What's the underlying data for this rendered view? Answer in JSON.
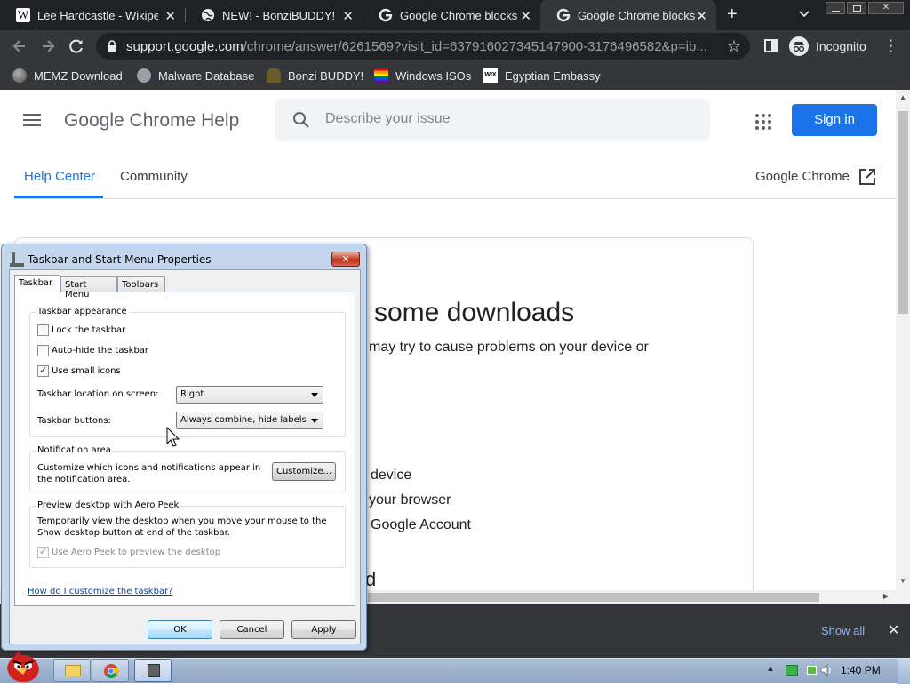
{
  "tabs": [
    {
      "title": "Lee Hardcastle - Wikipedia",
      "favicon": "wikipedia-icon"
    },
    {
      "title": "NEW! - BonziBUDDY!",
      "favicon": "globe-icon"
    },
    {
      "title": "Google Chrome blocks some downloads",
      "favicon": "google-icon"
    },
    {
      "title": "Google Chrome blocks some downloads",
      "favicon": "google-icon"
    }
  ],
  "new_tab_symbol": "+",
  "omnibox": {
    "domain": "support.google.com",
    "path": "/chrome/answer/6261569?visit_id=637916027345147900-3176496582&p=ib..."
  },
  "profile": {
    "label": "Incognito"
  },
  "bookmarks": [
    {
      "label": "MEMZ Download"
    },
    {
      "label": "Malware Database"
    },
    {
      "label": "Bonzi BUDDY!"
    },
    {
      "label": "Windows ISOs"
    },
    {
      "label": "Egyptian Embassy"
    }
  ],
  "help_page": {
    "title": "Google Chrome Help",
    "search_placeholder": "Describe your issue",
    "sign_in": "Sign in",
    "nav": {
      "help_center": "Help Center",
      "community": "Community",
      "product": "Google Chrome"
    },
    "article_heading": "some downloads",
    "article_intro": "may try to cause problems on your device or",
    "list_items": [
      "device",
      "your browser",
      "Google Account"
    ],
    "partial_heading": "d"
  },
  "downloads": {
    "show_all": "Show all"
  },
  "dialog": {
    "title": "Taskbar and Start Menu Properties",
    "tabs": [
      "Taskbar",
      "Start Menu",
      "Toolbars"
    ],
    "appearance": {
      "title": "Taskbar appearance",
      "lock": {
        "label": "Lock the taskbar",
        "checked": false
      },
      "autohide": {
        "label": "Auto-hide the taskbar",
        "checked": false
      },
      "small_icons": {
        "label": "Use small icons",
        "checked": true
      },
      "location_label": "Taskbar location on screen:",
      "location_value": "Right",
      "buttons_label": "Taskbar buttons:",
      "buttons_value": "Always combine, hide labels"
    },
    "notification": {
      "title": "Notification area",
      "text": "Customize which icons and notifications appear in the notification area.",
      "button": "Customize..."
    },
    "peek": {
      "title": "Preview desktop with Aero Peek",
      "text": "Temporarily view the desktop when you move your mouse to the Show desktop button at end of the taskbar.",
      "checkbox": {
        "label": "Use Aero Peek to preview the desktop",
        "checked": true,
        "disabled": true
      }
    },
    "help_link": "How do I customize the taskbar?",
    "buttons": {
      "ok": "OK",
      "cancel": "Cancel",
      "apply": "Apply"
    }
  },
  "taskbar": {
    "clock": "1:40 PM"
  },
  "colors": {
    "chrome_dark": "#202124",
    "toolbar": "#35363a",
    "google_blue": "#1a73e8",
    "link": "#0645ad"
  }
}
